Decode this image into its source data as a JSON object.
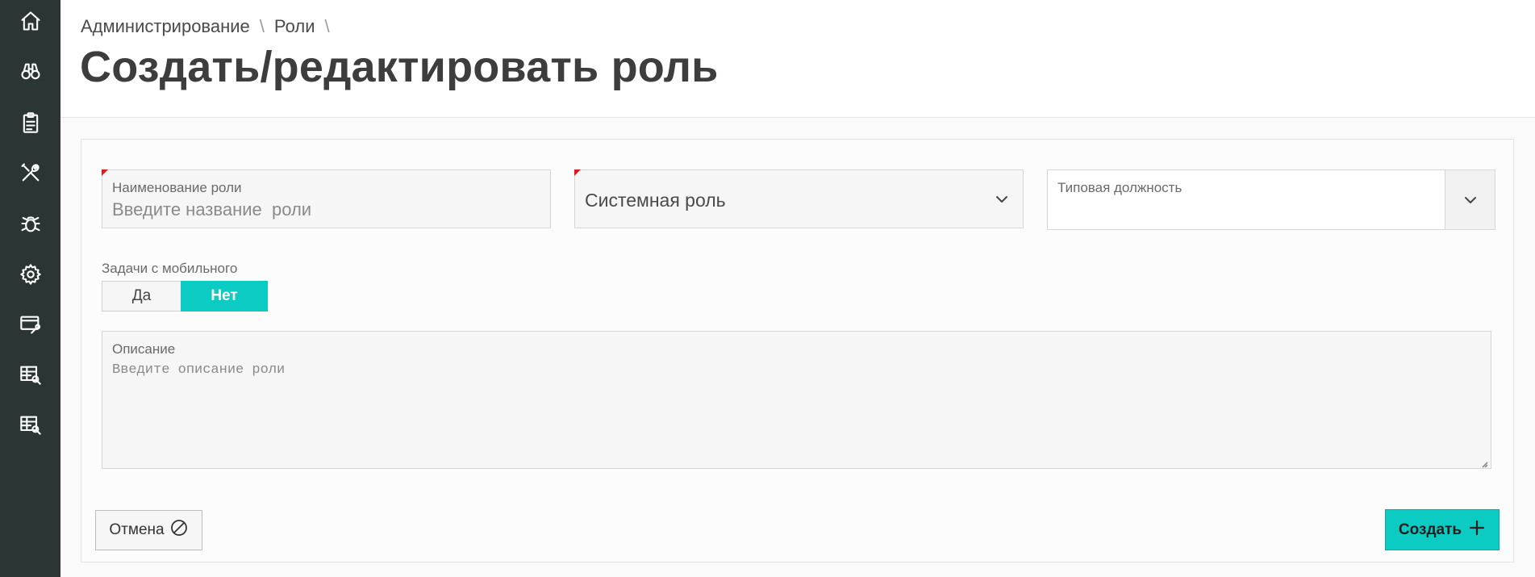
{
  "sidebar": {
    "items": [
      {
        "icon": "home-icon"
      },
      {
        "icon": "binoculars-icon"
      },
      {
        "icon": "clipboard-icon"
      },
      {
        "icon": "tools-icon"
      },
      {
        "icon": "bug-icon"
      },
      {
        "icon": "gear-icon"
      },
      {
        "icon": "screen-wrench-icon"
      },
      {
        "icon": "table-search-icon"
      },
      {
        "icon": "table-search-icon"
      }
    ],
    "background": "#2b3634"
  },
  "breadcrumb": {
    "items": [
      "Администрирование",
      "Роли"
    ],
    "separator": "\\"
  },
  "page": {
    "title": "Создать/редактировать роль"
  },
  "form": {
    "role_name": {
      "label": "Наименование роли",
      "placeholder": "Введите название  роли",
      "value": "",
      "required": true
    },
    "system_role": {
      "selected": "Системная роль",
      "required": true
    },
    "typical_position": {
      "label": "Типовая должность",
      "selected": ""
    },
    "mobile_tasks": {
      "label": "Задачи с мобильного",
      "options": [
        "Да",
        "Нет"
      ],
      "selected": "Нет"
    },
    "description": {
      "label": "Описание",
      "placeholder": "Введите описание роли",
      "value": ""
    }
  },
  "actions": {
    "cancel_label": "Отмена",
    "create_label": "Создать"
  },
  "colors": {
    "accent": "#0ccbc3",
    "required_marker": "#e01818"
  }
}
